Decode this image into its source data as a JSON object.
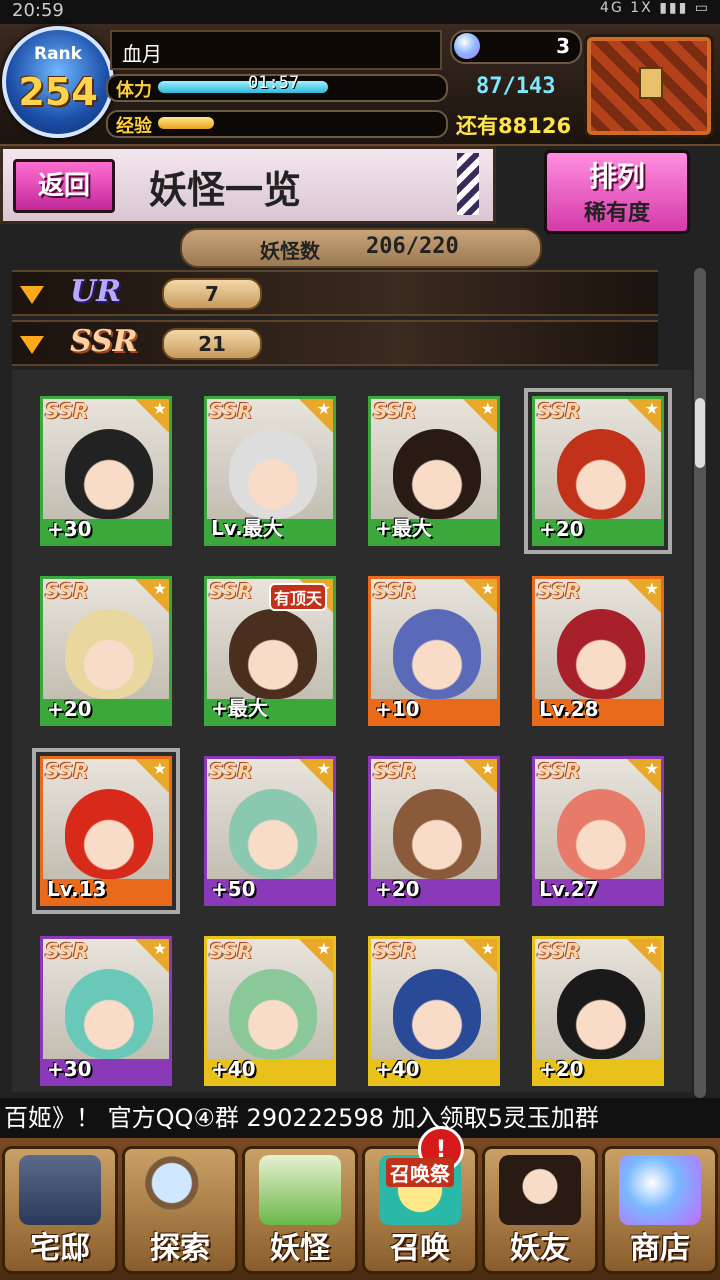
{
  "statusbar": {
    "time": "20:59",
    "indicators": "4G 1X"
  },
  "player": {
    "rank_label": "Rank",
    "rank": "254",
    "name": "血月",
    "stamina_label": "体力",
    "stamina_timer": "01:57",
    "stamina_value": "87/143",
    "stamina_fraction": 0.61,
    "exp_label": "经验",
    "exp_remaining": "还有88126",
    "exp_fraction": 0.2,
    "gems": "3"
  },
  "page": {
    "back_label": "返回",
    "title": "妖怪一览",
    "sort_line1": "排列",
    "sort_line2": "稀有度",
    "count_label": "妖怪数",
    "count_value": "206/220"
  },
  "rarity_groups": [
    {
      "badge": "UR",
      "count": "7"
    },
    {
      "badge": "SSR",
      "count": "21"
    }
  ],
  "cards": [
    {
      "rarity": "SSR",
      "level": "+30",
      "frame": "#3aa83a",
      "hair": "#222"
    },
    {
      "rarity": "SSR",
      "level": "Lv.最大",
      "frame": "#3aa83a",
      "hair": "#ddd"
    },
    {
      "rarity": "SSR",
      "level": "+最大",
      "frame": "#3aa83a",
      "hair": "#2a1a14"
    },
    {
      "rarity": "SSR",
      "level": "+20",
      "frame": "#3aa83a",
      "hair": "#c2321a",
      "selected": true
    },
    {
      "rarity": "SSR",
      "level": "+20",
      "frame": "#3aa83a",
      "hair": "#e8d8a0"
    },
    {
      "rarity": "SSR",
      "level": "+最大",
      "frame": "#3aa83a",
      "hair": "#4a2e1e",
      "tag": "有顶天"
    },
    {
      "rarity": "SSR",
      "level": "+10",
      "frame": "#e86a1a",
      "hair": "#5a6ab8"
    },
    {
      "rarity": "SSR",
      "level": "Lv.28",
      "frame": "#e86a1a",
      "hair": "#a8202a"
    },
    {
      "rarity": "SSR",
      "level": "Lv.13",
      "frame": "#e86a1a",
      "hair": "#d82a1a",
      "selected": true
    },
    {
      "rarity": "SSR",
      "level": "+50",
      "frame": "#8a3ab8",
      "hair": "#8ac8b0"
    },
    {
      "rarity": "SSR",
      "level": "+20",
      "frame": "#8a3ab8",
      "hair": "#8a5a3a"
    },
    {
      "rarity": "SSR",
      "level": "Lv.27",
      "frame": "#8a3ab8",
      "hair": "#e87a6a"
    },
    {
      "rarity": "SSR",
      "level": "+30",
      "frame": "#8a3ab8",
      "hair": "#6ac8b8"
    },
    {
      "rarity": "SSR",
      "level": "+40",
      "frame": "#e8c21a",
      "hair": "#8ac89a"
    },
    {
      "rarity": "SSR",
      "level": "+40",
      "frame": "#e8c21a",
      "hair": "#2a4a98"
    },
    {
      "rarity": "SSR",
      "level": "+20",
      "frame": "#e8c21a",
      "hair": "#1a1a1a"
    }
  ],
  "ticker": "百姬》！ 官方QQ④群 290222598     加入领取5灵玉加群",
  "nav": [
    {
      "label": "宅邸",
      "icon": "house-icon"
    },
    {
      "label": "探索",
      "icon": "magnifier-icon"
    },
    {
      "label": "妖怪",
      "icon": "scroll-icon"
    },
    {
      "label": "召唤",
      "icon": "summon-star-icon",
      "badge": "!",
      "sub": "召唤祭"
    },
    {
      "label": "妖友",
      "icon": "friend-icon"
    },
    {
      "label": "商店",
      "icon": "orb-icon"
    }
  ]
}
